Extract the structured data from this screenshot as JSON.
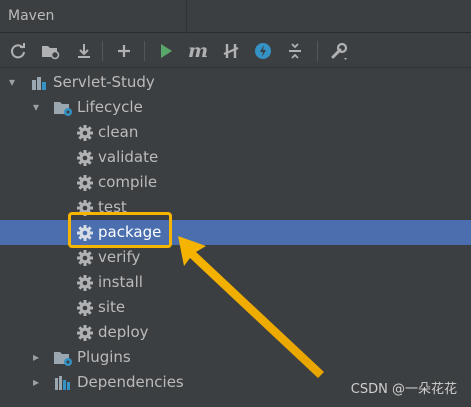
{
  "window": {
    "title": "Maven"
  },
  "toolbar": {
    "buttons": [
      {
        "name": "reload-icon",
        "glyph": "⟳"
      },
      {
        "name": "add-maven-project-icon",
        "glyph": "📁"
      },
      {
        "name": "download-sources-icon",
        "glyph": "⤓"
      },
      {
        "name": "add-icon",
        "glyph": "+"
      },
      {
        "name": "run-icon",
        "glyph": "▶"
      },
      {
        "name": "execute-goal-icon",
        "glyph": "m"
      },
      {
        "name": "skip-tests-icon",
        "glyph": "⫽"
      },
      {
        "name": "offline-mode-icon",
        "glyph": "ϟ"
      },
      {
        "name": "collapse-all-icon",
        "glyph": "⇕"
      },
      {
        "name": "settings-wrench-icon",
        "glyph": "🔧"
      }
    ]
  },
  "tree": {
    "root": {
      "label": "Servlet-Study",
      "icon": "maven-module-icon"
    },
    "lifecycle": {
      "label": "Lifecycle",
      "phases": [
        "clean",
        "validate",
        "compile",
        "test",
        "package",
        "verify",
        "install",
        "site",
        "deploy"
      ],
      "selected": "package"
    },
    "plugins": {
      "label": "Plugins"
    },
    "dependencies": {
      "label": "Dependencies"
    }
  },
  "colors": {
    "background": "#3c3f41",
    "selection": "#4b6eaf",
    "highlight": "#f7b500",
    "run_green": "#59a869",
    "offline_blue": "#3592c4"
  },
  "watermark": "CSDN @一朵花花"
}
